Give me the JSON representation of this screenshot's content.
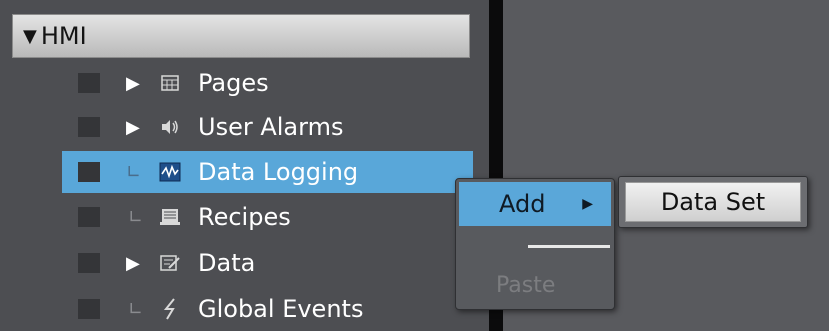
{
  "tree": {
    "root": {
      "label": "HMI",
      "expander": "▼"
    },
    "items": [
      {
        "label": "Pages",
        "icon": "pages-icon",
        "has_children": true
      },
      {
        "label": "User Alarms",
        "icon": "speaker-icon",
        "has_children": true
      },
      {
        "label": "Data Logging",
        "icon": "data-logging-icon",
        "has_children": false,
        "selected": true
      },
      {
        "label": "Recipes",
        "icon": "recipes-icon",
        "has_children": false
      },
      {
        "label": "Data",
        "icon": "data-icon",
        "has_children": true
      },
      {
        "label": "Global Events",
        "icon": "lightning-icon",
        "has_children": false
      }
    ],
    "expander_glyph": "▶",
    "leaf_glyph": "∟"
  },
  "context_menu": {
    "add_label": "Add",
    "paste_label": "Paste"
  },
  "submenu": {
    "item_label": "Data Set"
  },
  "colors": {
    "selection": "#59a7d9",
    "panel": "#4d4e52",
    "divider": "#0b0b0c"
  }
}
